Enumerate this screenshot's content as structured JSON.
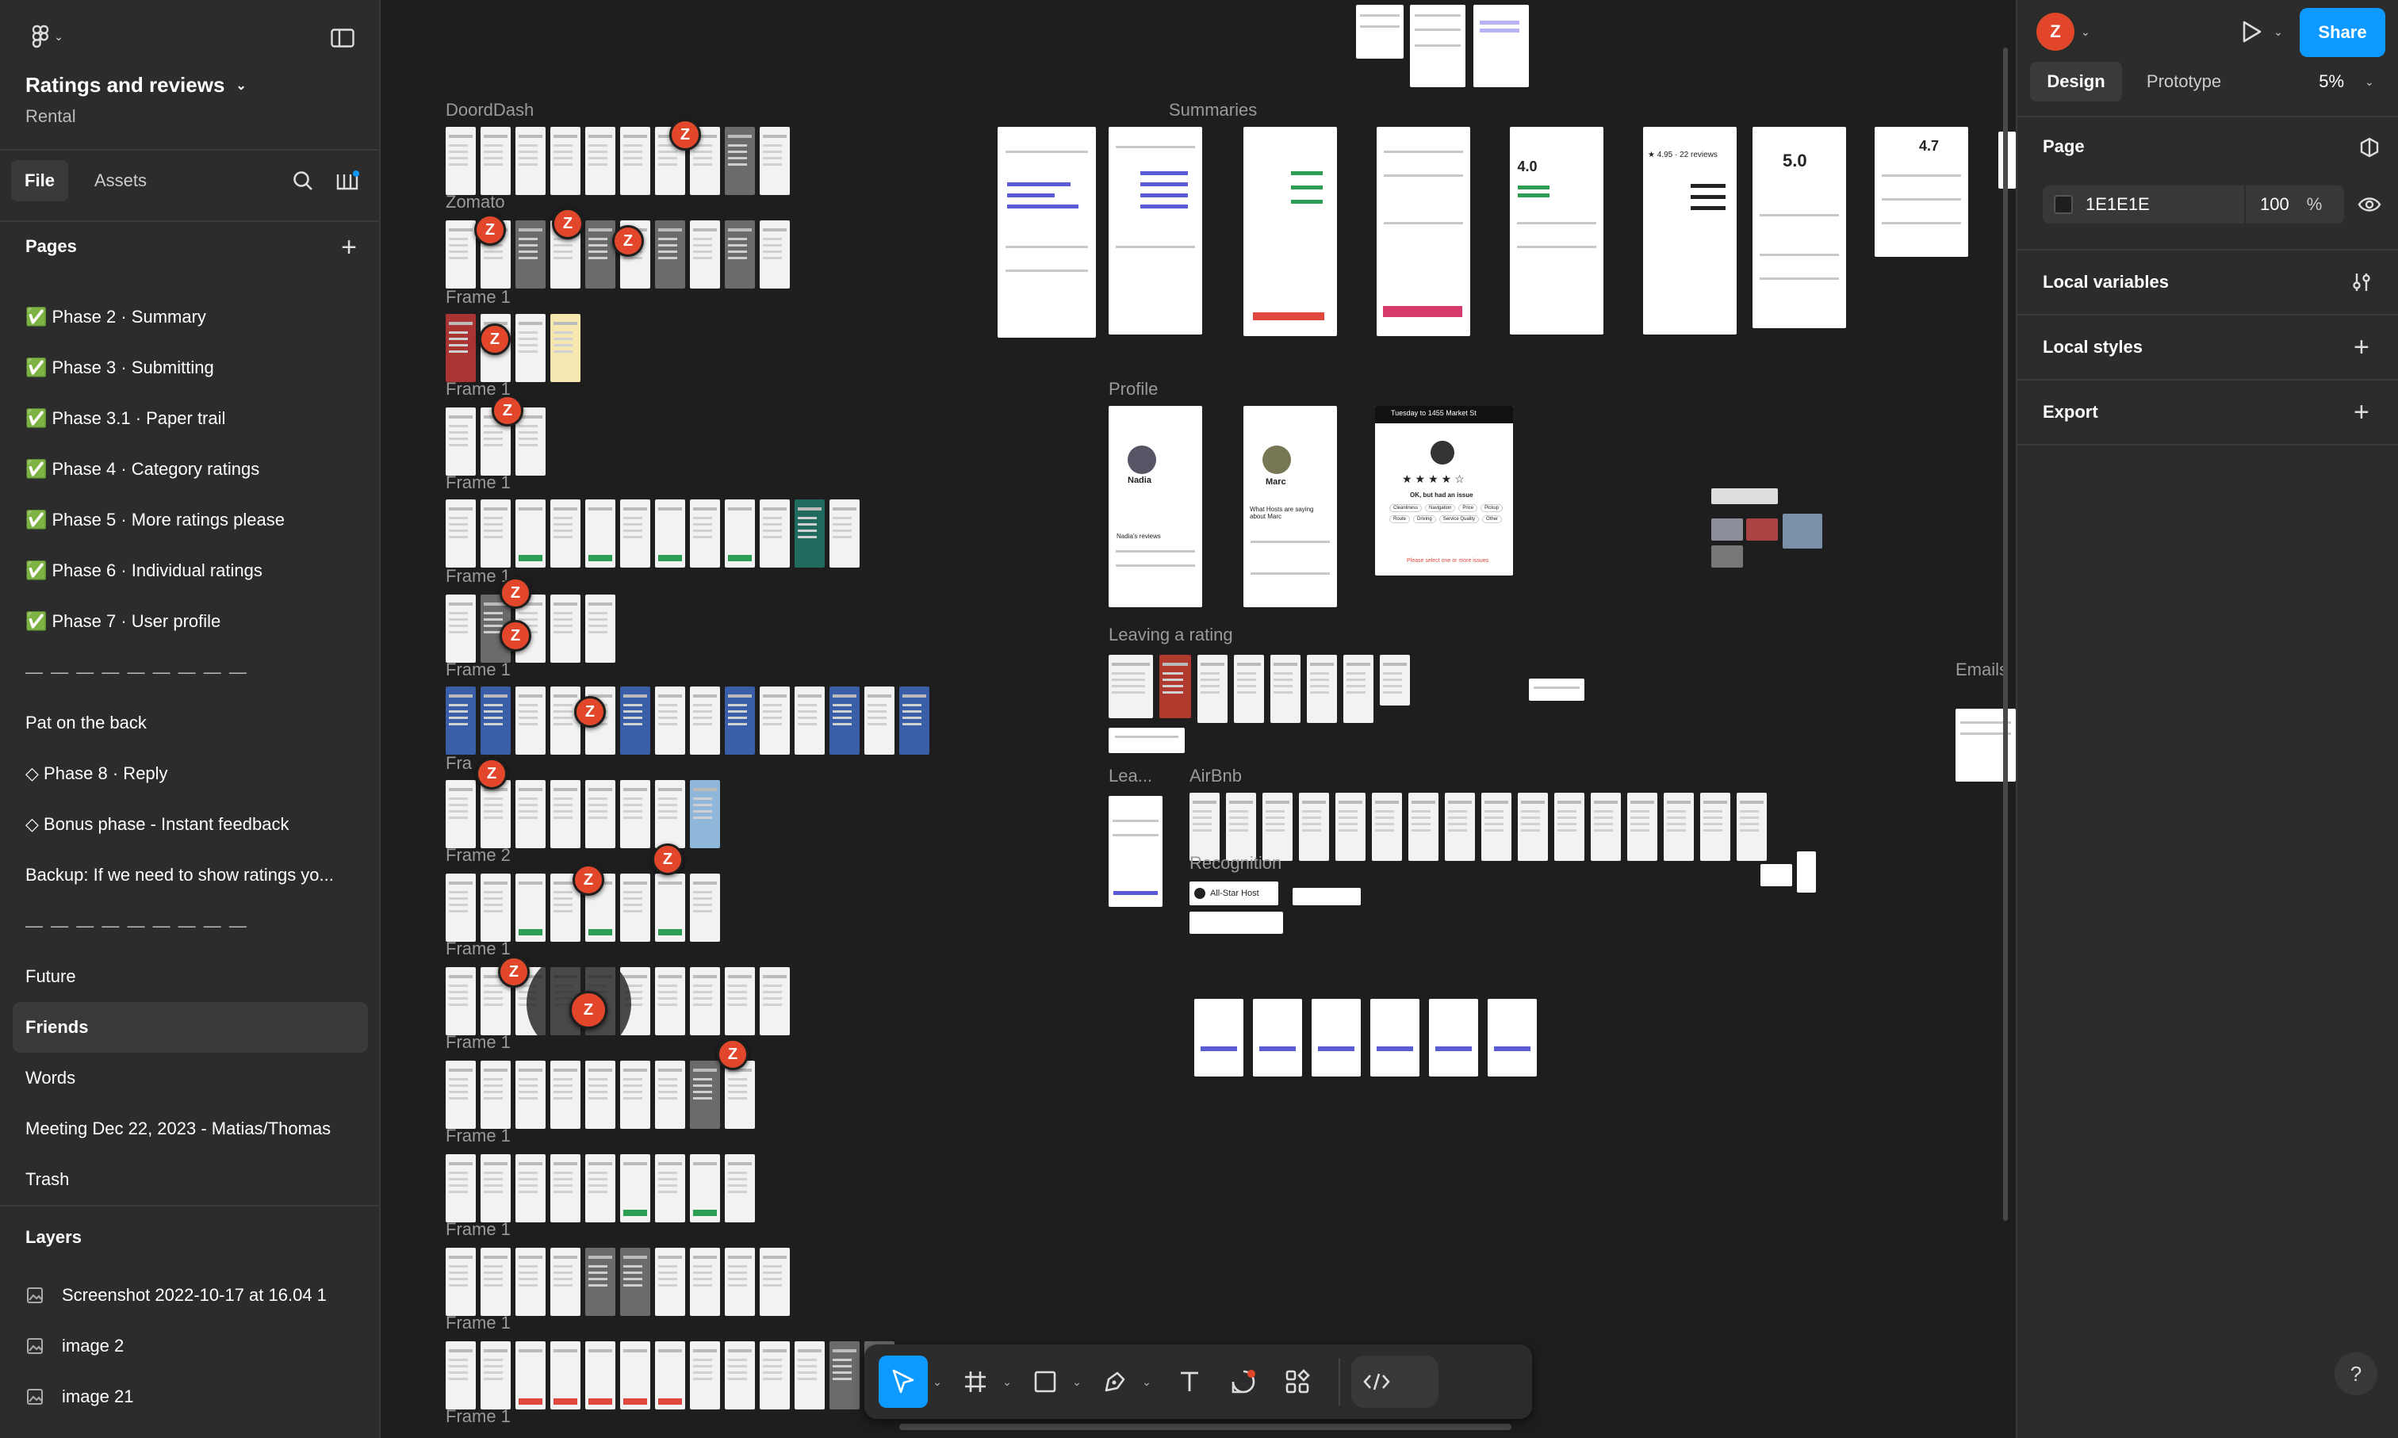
{
  "file": {
    "name": "Ratings and reviews",
    "project": "Rental"
  },
  "left_tabs": [
    "File",
    "Assets"
  ],
  "pages": {
    "title": "Pages",
    "items": [
      "✅ Phase 2 · Summary",
      "✅ Phase 3 · Submitting",
      "✅ Phase 3.1 · Paper trail",
      "✅ Phase 4 · Category ratings",
      "✅ Phase 5 · More ratings please",
      "✅ Phase 6 · Individual ratings",
      "✅ Phase 7 · User profile",
      "— — — — — — — — —",
      "Pat on the back",
      "◇ Phase 8 · Reply",
      "◇ Bonus phase - Instant feedback",
      "Backup: If we need to show ratings yo...",
      "— — — — — — — — —",
      "Future",
      "Friends",
      "Words",
      "Meeting Dec 22, 2023 - Matias/Thomas",
      "Trash"
    ],
    "selected_index": 14
  },
  "layers": {
    "title": "Layers",
    "items": [
      "Screenshot 2022-10-17 at 16.04 1",
      "image 2",
      "image 21"
    ]
  },
  "right_panel": {
    "avatar_letter": "Z",
    "share_label": "Share",
    "tabs": [
      "Design",
      "Prototype"
    ],
    "zoom": "5%",
    "page_section": "Page",
    "bg_hex": "1E1E1E",
    "bg_opacity": "100",
    "bg_opacity_unit": "%",
    "sections": [
      "Local variables",
      "Local styles",
      "Export"
    ]
  },
  "canvas": {
    "frame_labels": {
      "doordash": "DoordDash",
      "zomato": "Zomato",
      "frame1": "Frame 1",
      "frame2": "Frame 2",
      "fra": "Fra",
      "summaries": "Summaries",
      "profile": "Profile",
      "leaving": "Leaving a rating",
      "lea": "Lea...",
      "airbnb": "AirBnb",
      "recognition": "Recognition",
      "emails": "Emails"
    },
    "cursor_letter": "Z",
    "card_text": {
      "rating_40": "4.0",
      "rating_50": "5.0",
      "rating_47": "4.7",
      "nadia": "Nadia",
      "marc": "Marc",
      "allstar": "All-Star Host",
      "reviews_22": "★ 4.95 · 22 reviews",
      "nadias_reviews": "Nadia's reviews",
      "what_hosts": "What Hosts are saying about Marc",
      "tuesday": "Tuesday to 1455 Market St",
      "ok_issue": "OK, but had an issue",
      "issue_tags": [
        "Cleanliness",
        "Navigation",
        "Price",
        "Pickup",
        "Route",
        "Driving",
        "Service Quality",
        "Other"
      ],
      "please": "Please select one or more issues"
    }
  },
  "help_label": "?",
  "colors": {
    "accent": "#0d99ff",
    "cursor": "#e2472b",
    "canvas_bg": "#1e1e1e",
    "panel_bg": "#2c2c2c"
  }
}
